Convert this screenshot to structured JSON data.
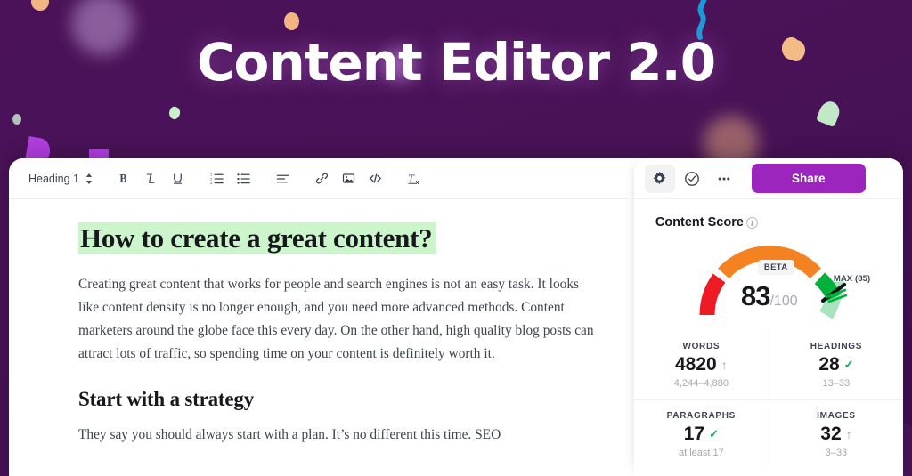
{
  "hero": {
    "title": "Content Editor 2.0",
    "background_color": "#4a1259",
    "accent_color": "#9c25bd"
  },
  "toolbar": {
    "heading_select_value": "Heading 1",
    "buttons": [
      {
        "name": "bold",
        "glyph": "B"
      },
      {
        "name": "italic",
        "glyph": "I"
      },
      {
        "name": "underline",
        "glyph": "U"
      },
      {
        "name": "ordered-list",
        "glyph": ""
      },
      {
        "name": "unordered-list",
        "glyph": ""
      },
      {
        "name": "align",
        "glyph": ""
      },
      {
        "name": "link",
        "glyph": ""
      },
      {
        "name": "image",
        "glyph": ""
      },
      {
        "name": "code",
        "glyph": "</>"
      },
      {
        "name": "clear-formatting",
        "glyph": ""
      }
    ]
  },
  "document": {
    "h1": "How to create a great content?",
    "h1_highlight_color": "#ccf5cc",
    "p1": "Creating great content that works for people and search engines is not an easy task. It looks like content density is no longer enough, and you need more advanced methods. Content marketers around the globe face this every day. On the other hand, high quality blog posts can attract lots of traffic, so spending time on your content is definitely worth it.",
    "h2": "Start with a strategy",
    "p2": "They say you should always start with a plan. It’s no different this time. SEO"
  },
  "panel": {
    "share_label": "Share",
    "icons": [
      {
        "name": "gear-icon",
        "active": true
      },
      {
        "name": "check-circle-icon",
        "active": false
      },
      {
        "name": "more-horizontal-icon",
        "active": false
      }
    ],
    "score_title": "Content Score",
    "beta_badge": "BETA",
    "score": "83",
    "score_denominator": "/100",
    "max_label": "MAX (85)",
    "gauge_colors": {
      "red": "#ed1c24",
      "orange": "#f58220",
      "green": "#00b23b",
      "light_green": "#a8e3bc"
    },
    "stats": [
      {
        "label": "WORDS",
        "value": "4820",
        "mark": "↑",
        "mark_type": "up",
        "range": "4,244–4,880"
      },
      {
        "label": "HEADINGS",
        "value": "28",
        "mark": "✓",
        "mark_type": "ok",
        "range": "13–33"
      },
      {
        "label": "PARAGRAPHS",
        "value": "17",
        "mark": "✓",
        "mark_type": "ok",
        "range": "at least 17"
      },
      {
        "label": "IMAGES",
        "value": "32",
        "mark": "↑",
        "mark_type": "up",
        "range": "3–33"
      }
    ]
  }
}
